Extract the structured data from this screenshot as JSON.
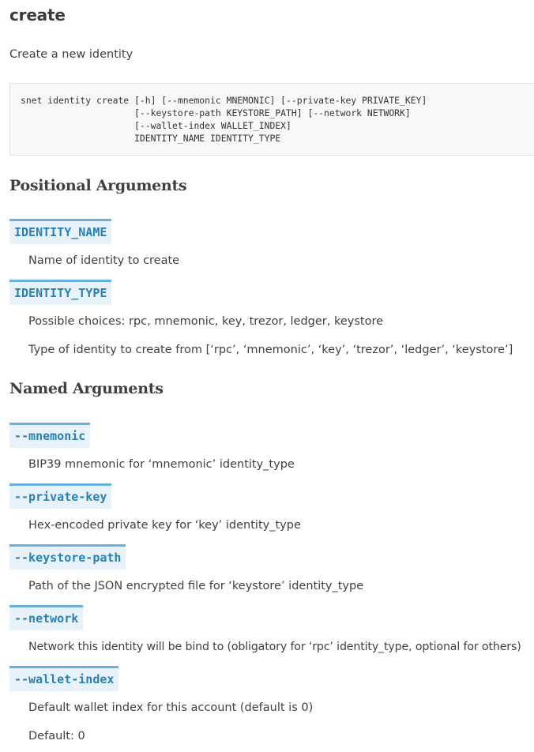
{
  "title": "create",
  "description": "Create a new identity",
  "usage_lines": [
    "snet identity create [-h] [--mnemonic MNEMONIC] [--private-key PRIVATE_KEY]",
    "                     [--keystore-path KEYSTORE_PATH] [--network NETWORK]",
    "                     [--wallet-index WALLET_INDEX]",
    "                     IDENTITY_NAME IDENTITY_TYPE"
  ],
  "positional": {
    "heading": "Positional Arguments",
    "args": [
      {
        "name": "IDENTITY_NAME",
        "lines": [
          "Name of identity to create"
        ]
      },
      {
        "name": "IDENTITY_TYPE",
        "lines": [
          "Possible choices: rpc, mnemonic, key, trezor, ledger, keystore",
          "Type of identity to create from [‘rpc’, ‘mnemonic’, ‘key’, ‘trezor’, ‘ledger’, ‘keystore’]"
        ]
      }
    ]
  },
  "named": {
    "heading": "Named Arguments",
    "args": [
      {
        "name": "--mnemonic",
        "lines": [
          "BIP39 mnemonic for ‘mnemonic’ identity_type"
        ]
      },
      {
        "name": "--private-key",
        "lines": [
          "Hex-encoded private key for ‘key’ identity_type"
        ]
      },
      {
        "name": "--keystore-path",
        "lines": [
          "Path of the JSON encrypted file for ‘keystore’ identity_type"
        ]
      },
      {
        "name": "--network",
        "lines": [
          "Network this identity will be bind to (obligatory for ‘rpc’ identity_type, optional for others)"
        ]
      },
      {
        "name": "--wallet-index",
        "lines": [
          "Default wallet index for this account (default is 0)",
          "Default: 0"
        ]
      }
    ]
  },
  "colors": {
    "arg_background": "#e7f2fa",
    "arg_border": "#6ab0de",
    "arg_text": "#2980b9",
    "code_background": "#f8f8f8"
  }
}
